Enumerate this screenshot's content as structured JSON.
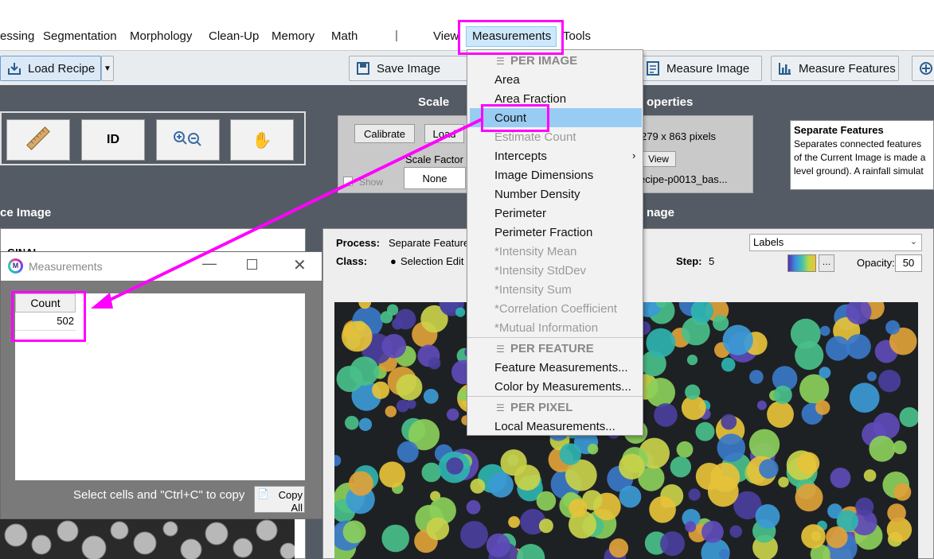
{
  "menubar": {
    "items": [
      "essing",
      "Segmentation",
      "Morphology",
      "Clean-Up",
      "Memory",
      "Math",
      "View",
      "Measurements",
      "Tools"
    ],
    "separator": "|"
  },
  "toolbar": {
    "load_recipe": "Load Recipe",
    "save_image": "Save Image",
    "measure_image": "Measure Image",
    "measure_features": "Measure Features"
  },
  "controls": {
    "id_label": "ID"
  },
  "scale": {
    "title": "Scale",
    "calibrate": "Calibrate",
    "load": "Load",
    "scale_factor_label": "Scale Factor",
    "scale_factor_value": "None",
    "show_label": "Show"
  },
  "properties": {
    "title": "operties",
    "dimensions": "279 x 863 pixels",
    "view": "View",
    "filename": "ecipe-p0013_bas..."
  },
  "separate_features": {
    "title": "Separate Features",
    "description": "Separates connected features of the Current Image is made a level ground). A rainfall simulat"
  },
  "source_image": {
    "title": "ce Image",
    "subtitle": "GINAL"
  },
  "current_image": {
    "title": "nage",
    "process_label": "Process:",
    "process_value": "Separate Feature",
    "class_label": "Class:",
    "class_value": "Selection Edit",
    "step_label": "Step:",
    "step_value": "5",
    "labels_select": "Labels",
    "opacity_label": "Opacity:",
    "opacity_value": "50"
  },
  "measurements_window": {
    "title": "Measurements",
    "column_header": "Count",
    "value": "502",
    "hint": "Select cells and \"Ctrl+C\" to copy",
    "copy_all": "Copy All"
  },
  "dropdown": {
    "per_image": "PER IMAGE",
    "per_image_items": [
      {
        "label": "Area",
        "enabled": true
      },
      {
        "label": "Area Fraction",
        "enabled": true
      },
      {
        "label": "Count",
        "enabled": true,
        "highlighted": true
      },
      {
        "label": "Estimate Count",
        "enabled": false
      },
      {
        "label": "Intercepts",
        "enabled": true,
        "submenu": true
      },
      {
        "label": "Image Dimensions",
        "enabled": true
      },
      {
        "label": "Number Density",
        "enabled": true
      },
      {
        "label": "Perimeter",
        "enabled": true
      },
      {
        "label": "Perimeter Fraction",
        "enabled": true
      },
      {
        "label": "*Intensity Mean",
        "enabled": false
      },
      {
        "label": "*Intensity StdDev",
        "enabled": false
      },
      {
        "label": "*Intensity Sum",
        "enabled": false
      },
      {
        "label": "*Correlation Coefficient",
        "enabled": false
      },
      {
        "label": "*Mutual Information",
        "enabled": false
      }
    ],
    "per_feature": "PER FEATURE",
    "per_feature_items": [
      "Feature Measurements...",
      "Color by Measurements..."
    ],
    "per_pixel": "PER PIXEL",
    "per_pixel_items": [
      "Local Measurements..."
    ]
  },
  "colors": {
    "highlight": "#ff00ff",
    "menu_selected": "#99ccf3",
    "panel_dark": "#545b64"
  }
}
